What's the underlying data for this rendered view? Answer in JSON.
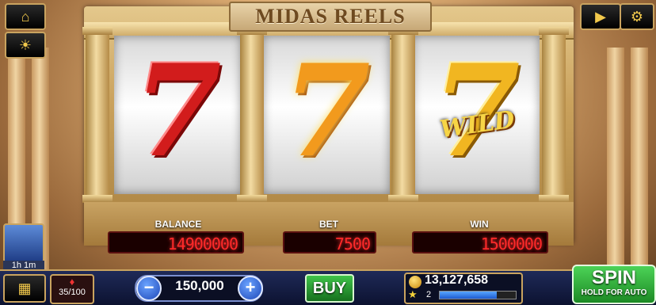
{
  "game": {
    "title": "MIDAS REELS"
  },
  "reels": {
    "symbols": [
      "red-seven-symbol",
      "fire-seven-symbol",
      "gold-seven-wild-symbol"
    ],
    "wild_label": "WILD"
  },
  "meters": {
    "balance_label": "BALANCE",
    "balance_value": "14900000",
    "bet_label": "BET",
    "bet_value": "7500",
    "win_label": "WIN",
    "win_value": "1500000"
  },
  "controls": {
    "bet_amount": "150,000",
    "minus": "−",
    "plus": "+",
    "buy_label": "BUY",
    "spin_label": "SPIN",
    "spin_sub": "HOLD FOR AUTO"
  },
  "player": {
    "coins": "13,127,658",
    "level": "2",
    "xp_fraction": 0.75,
    "bonus_count": "35/100",
    "timer": "1h 1m"
  },
  "icons": [
    "home-icon",
    "sun-icon",
    "menu-grid-icon",
    "video-icon",
    "gear-icon"
  ]
}
